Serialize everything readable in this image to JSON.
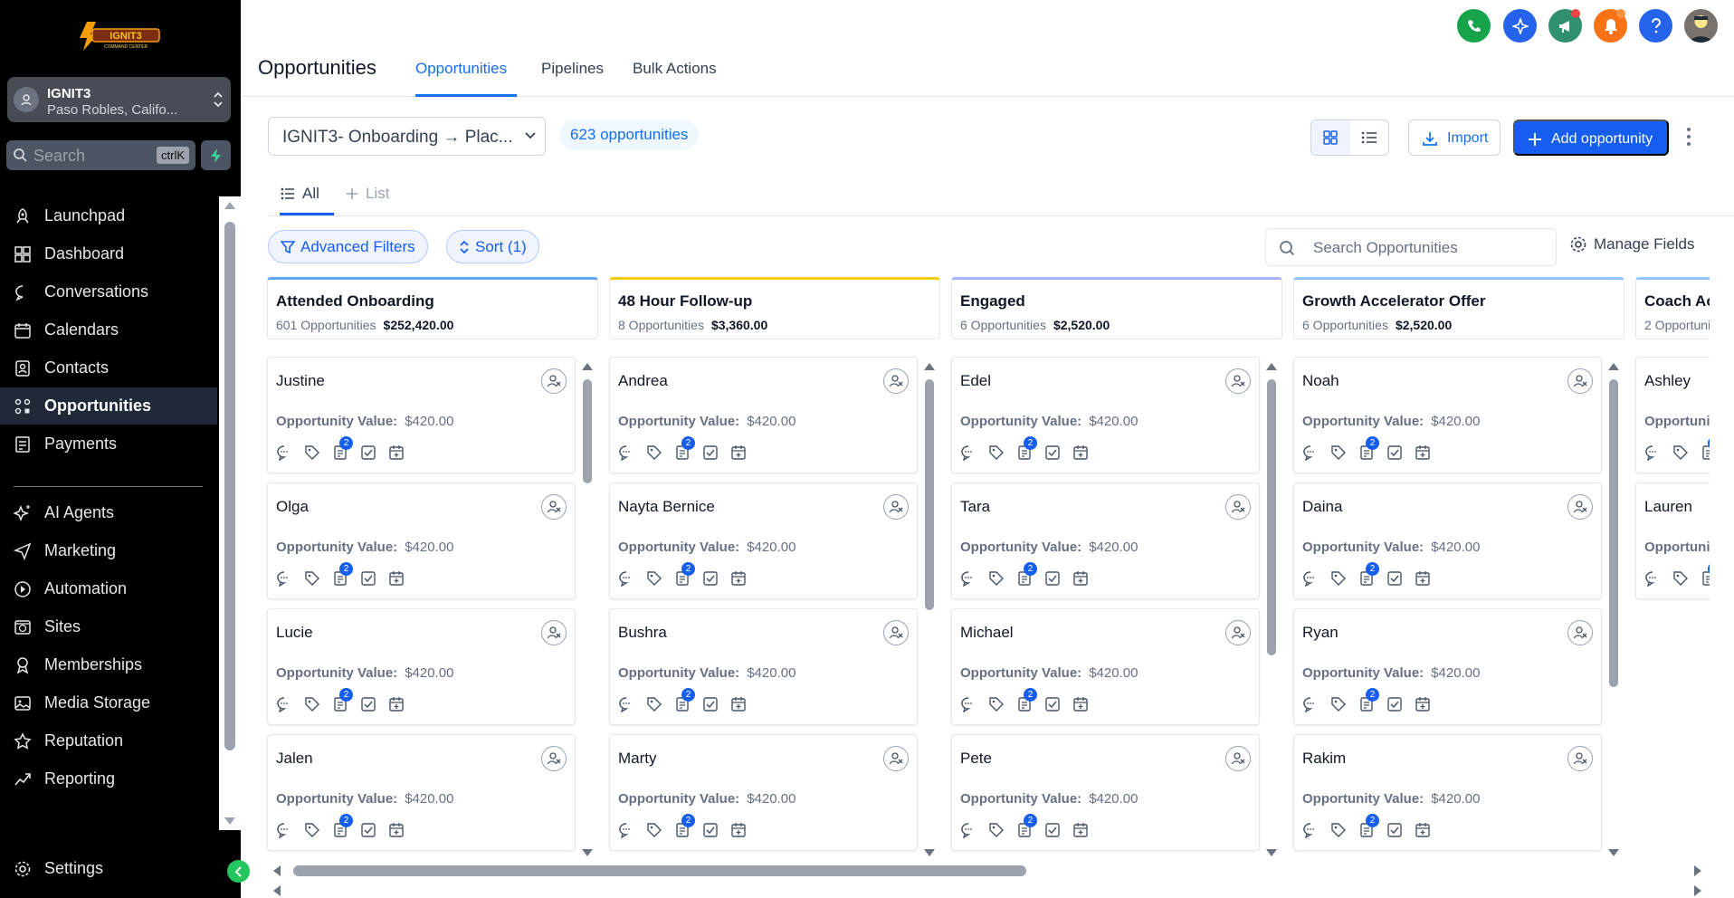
{
  "app": {
    "brand_lines": [
      "IGNIT3",
      "COMMAND CENTER"
    ],
    "location": {
      "name": "IGNIT3",
      "address": "Paso Robles, Califo..."
    },
    "search": {
      "placeholder": "Search",
      "shortcut": "ctrlK"
    }
  },
  "sidebar": {
    "items": [
      {
        "label": "Launchpad",
        "icon": "rocket-icon"
      },
      {
        "label": "Dashboard",
        "icon": "grid-icon"
      },
      {
        "label": "Conversations",
        "icon": "chat-icon"
      },
      {
        "label": "Calendars",
        "icon": "calendar-icon"
      },
      {
        "label": "Contacts",
        "icon": "contacts-icon"
      },
      {
        "label": "Opportunities",
        "icon": "funnel-icon",
        "active": true
      },
      {
        "label": "Payments",
        "icon": "payments-icon"
      },
      {
        "label": "AI Agents",
        "icon": "sparkle-icon"
      },
      {
        "label": "Marketing",
        "icon": "send-icon"
      },
      {
        "label": "Automation",
        "icon": "automation-icon"
      },
      {
        "label": "Sites",
        "icon": "globe-icon"
      },
      {
        "label": "Memberships",
        "icon": "award-icon"
      },
      {
        "label": "Media Storage",
        "icon": "image-icon"
      },
      {
        "label": "Reputation",
        "icon": "star-icon"
      },
      {
        "label": "Reporting",
        "icon": "trend-icon"
      }
    ],
    "settings_label": "Settings"
  },
  "header": {
    "title": "Opportunities",
    "tabs": [
      "Opportunities",
      "Pipelines",
      "Bulk Actions"
    ],
    "icons": [
      {
        "name": "phone-icon",
        "color": "#16a34a"
      },
      {
        "name": "ai-sparkle-icon",
        "color": "#2563eb"
      },
      {
        "name": "megaphone-icon",
        "color": "#2f8f6e"
      },
      {
        "name": "bell-icon",
        "color": "#f97316"
      },
      {
        "name": "help-icon",
        "color": "#2563eb"
      },
      {
        "name": "avatar-icon",
        "color": "#78716c"
      }
    ]
  },
  "toolbar": {
    "pipeline": "IGNIT3- Onboarding → Plac...",
    "count": "623 opportunities",
    "import_label": "Import",
    "add_label": "Add opportunity"
  },
  "subtabs": {
    "all": "All",
    "list": "List"
  },
  "filters": {
    "advanced": "Advanced Filters",
    "sort": "Sort (1)",
    "search_placeholder": "Search Opportunities",
    "manage_fields": "Manage Fields"
  },
  "value_label": "Opportunity Value:",
  "icon_badge": "2",
  "columns": [
    {
      "title": "Attended Onboarding",
      "count": "601 Opportunities",
      "amount": "$252,420.00",
      "color": "#60a5fa",
      "cards": [
        {
          "name": "Justine",
          "value": "$420.00"
        },
        {
          "name": "Olga",
          "value": "$420.00"
        },
        {
          "name": "Lucie",
          "value": "$420.00"
        },
        {
          "name": "Jalen",
          "value": "$420.00"
        }
      ]
    },
    {
      "title": "48 Hour Follow-up",
      "count": "8 Opportunities",
      "amount": "$3,360.00",
      "color": "#facc15",
      "cards": [
        {
          "name": "Andrea",
          "value": "$420.00"
        },
        {
          "name": "Nayta Bernice",
          "value": "$420.00"
        },
        {
          "name": "Bushra",
          "value": "$420.00"
        },
        {
          "name": "Marty",
          "value": "$420.00"
        }
      ]
    },
    {
      "title": "Engaged",
      "count": "6 Opportunities",
      "amount": "$2,520.00",
      "color": "#a5b4fc",
      "cards": [
        {
          "name": "Edel",
          "value": "$420.00"
        },
        {
          "name": "Tara",
          "value": "$420.00"
        },
        {
          "name": "Michael",
          "value": "$420.00"
        },
        {
          "name": "Pete",
          "value": "$420.00"
        }
      ]
    },
    {
      "title": "Growth Accelerator Offer",
      "count": "6 Opportunities",
      "amount": "$2,520.00",
      "color": "#93c5fd",
      "cards": [
        {
          "name": "Noah",
          "value": "$420.00"
        },
        {
          "name": "Daina",
          "value": "$420.00"
        },
        {
          "name": "Ryan",
          "value": "$420.00"
        },
        {
          "name": "Rakim",
          "value": "$420.00"
        }
      ]
    },
    {
      "title": "Coach Ac",
      "count": "2 Opportuni",
      "amount": "",
      "color": "#93c5fd",
      "cards": [
        {
          "name": "Ashley",
          "value": ""
        },
        {
          "name": "Lauren",
          "value": ""
        }
      ]
    }
  ]
}
